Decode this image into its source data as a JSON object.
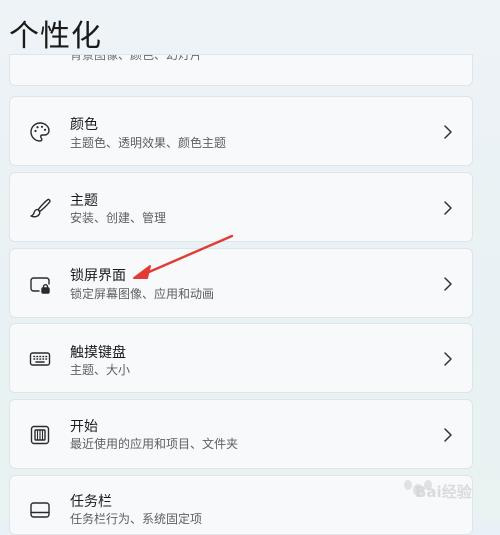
{
  "page": {
    "title": "个性化"
  },
  "items": [
    {
      "label": "",
      "description": "背景图像、颜色、幻灯片",
      "icon": "image-icon"
    },
    {
      "label": "颜色",
      "description": "主题色、透明效果、颜色主题",
      "icon": "palette-icon"
    },
    {
      "label": "主题",
      "description": "安装、创建、管理",
      "icon": "brush-icon"
    },
    {
      "label": "锁屏界面",
      "description": "锁定屏幕图像、应用和动画",
      "icon": "lock-screen-icon"
    },
    {
      "label": "触摸键盘",
      "description": "主题、大小",
      "icon": "keyboard-icon"
    },
    {
      "label": "开始",
      "description": "最近使用的应用和项目、文件夹",
      "icon": "start-icon"
    },
    {
      "label": "任务栏",
      "description": "任务栏行为、系统固定项",
      "icon": "taskbar-icon"
    }
  ],
  "watermark": {
    "text": "Bai经验"
  },
  "colors": {
    "annotation_arrow": "#e23b35"
  }
}
